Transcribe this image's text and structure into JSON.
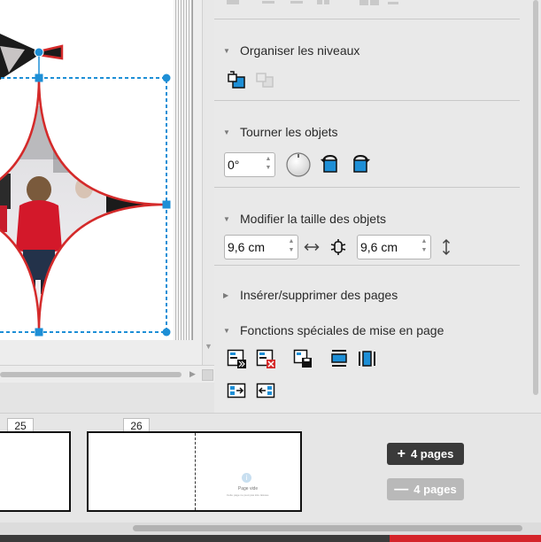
{
  "panel": {
    "sections": {
      "levels": {
        "title": "Organiser les niveaux"
      },
      "rotate": {
        "title": "Tourner les objets",
        "angle": "0°"
      },
      "resize": {
        "title": "Modifier la taille des objets",
        "width": "9,6 cm",
        "height": "9,6 cm"
      },
      "pages": {
        "title": "Insérer/supprimer des pages"
      },
      "layout": {
        "title": "Fonctions spéciales de mise en page"
      }
    }
  },
  "strip": {
    "pages": [
      {
        "number": "25"
      },
      {
        "number": "26",
        "empty_title": "Page vide",
        "empty_hint": "Cette page ne peut pas être laissée."
      }
    ],
    "add_button": "4 pages",
    "remove_button": "4 pages"
  },
  "colors": {
    "accent": "#1e8fd6",
    "selection": "#1e8fd6",
    "frame": "#d42a2a",
    "dark_button": "#3a3a3a",
    "disabled_button": "#b9b9b9"
  }
}
